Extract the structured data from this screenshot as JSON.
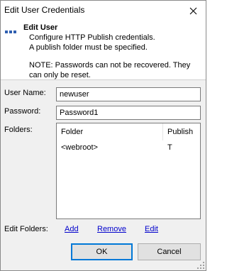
{
  "window": {
    "title": "Edit User Credentials"
  },
  "banner": {
    "heading": "Edit User",
    "lines": [
      "Configure HTTP Publish credentials.",
      "A publish folder must be specified.",
      "NOTE: Passwords can not be recovered. They",
      "can only be reset."
    ]
  },
  "form": {
    "username_label": "User Name:",
    "username_value": "newuser",
    "password_label": "Password:",
    "password_value": "Password1",
    "folders_label": "Folders:"
  },
  "folders_list": {
    "columns": [
      "Folder",
      "Publish"
    ],
    "rows": [
      {
        "folder": "<webroot>",
        "publish": "T"
      }
    ]
  },
  "edit_folders": {
    "label": "Edit Folders:",
    "add": "Add",
    "remove": "Remove",
    "edit": "Edit"
  },
  "buttons": {
    "ok": "OK",
    "cancel": "Cancel"
  },
  "colors": {
    "link": "#0000cc",
    "default_button_border": "#0078d7",
    "dialog_bg": "#f0f0f0"
  }
}
